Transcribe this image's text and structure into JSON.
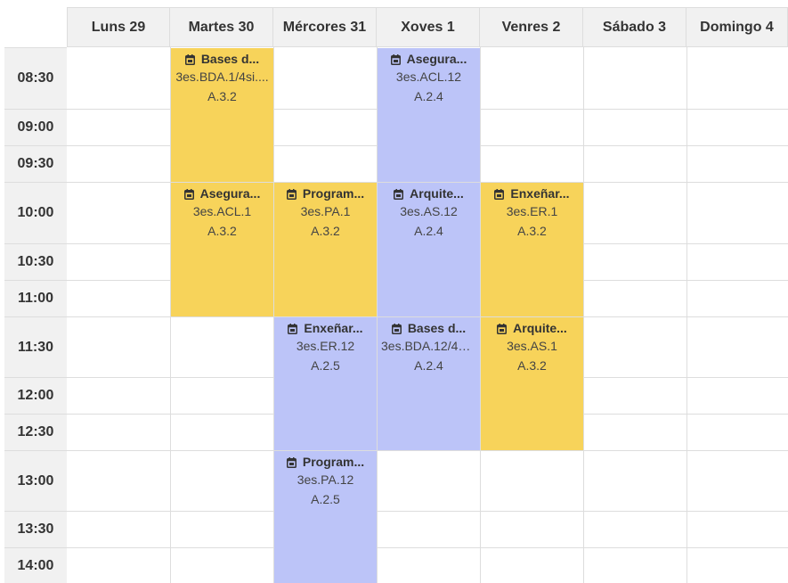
{
  "days": [
    "Luns 29",
    "Martes 30",
    "Mércores 31",
    "Xoves 1",
    "Venres 2",
    "Sábado 3",
    "Domingo 4"
  ],
  "times": [
    "08:30",
    "09:00",
    "09:30",
    "10:00",
    "10:30",
    "11:00",
    "11:30",
    "12:00",
    "12:30",
    "13:00",
    "13:30",
    "14:00"
  ],
  "events": [
    {
      "day": 1,
      "start": 0,
      "span": 3,
      "color": "yellow",
      "title": "Bases d...",
      "group": "3es.BDA.1/4si....",
      "room": "A.3.2"
    },
    {
      "day": 3,
      "start": 0,
      "span": 3,
      "color": "blue",
      "title": "Asegura...",
      "group": "3es.ACL.12",
      "room": "A.2.4"
    },
    {
      "day": 1,
      "start": 3,
      "span": 3,
      "color": "yellow",
      "title": "Asegura...",
      "group": "3es.ACL.1",
      "room": "A.3.2"
    },
    {
      "day": 2,
      "start": 3,
      "span": 3,
      "color": "yellow",
      "title": "Program...",
      "group": "3es.PA.1",
      "room": "A.3.2"
    },
    {
      "day": 3,
      "start": 3,
      "span": 3,
      "color": "blue",
      "title": "Arquite...",
      "group": "3es.AS.12",
      "room": "A.2.4"
    },
    {
      "day": 4,
      "start": 3,
      "span": 3,
      "color": "yellow",
      "title": "Enxeñar...",
      "group": "3es.ER.1",
      "room": "A.3.2"
    },
    {
      "day": 2,
      "start": 6,
      "span": 3,
      "color": "blue",
      "title": "Enxeñar...",
      "group": "3es.ER.12",
      "room": "A.2.5"
    },
    {
      "day": 3,
      "start": 6,
      "span": 3,
      "color": "blue",
      "title": "Bases d...",
      "group": "3es.BDA.12/4si...",
      "room": "A.2.4"
    },
    {
      "day": 4,
      "start": 6,
      "span": 3,
      "color": "yellow",
      "title": "Arquite...",
      "group": "3es.AS.1",
      "room": "A.3.2"
    },
    {
      "day": 2,
      "start": 9,
      "span": 3,
      "color": "blue",
      "title": "Program...",
      "group": "3es.PA.12",
      "room": "A.2.5"
    }
  ],
  "colors": {
    "yellow": "#f7d35a",
    "blue": "#bcc4f8",
    "grid": "#dddddd",
    "header_bg": "#f1f1f1"
  },
  "icon": "calendar-icon"
}
